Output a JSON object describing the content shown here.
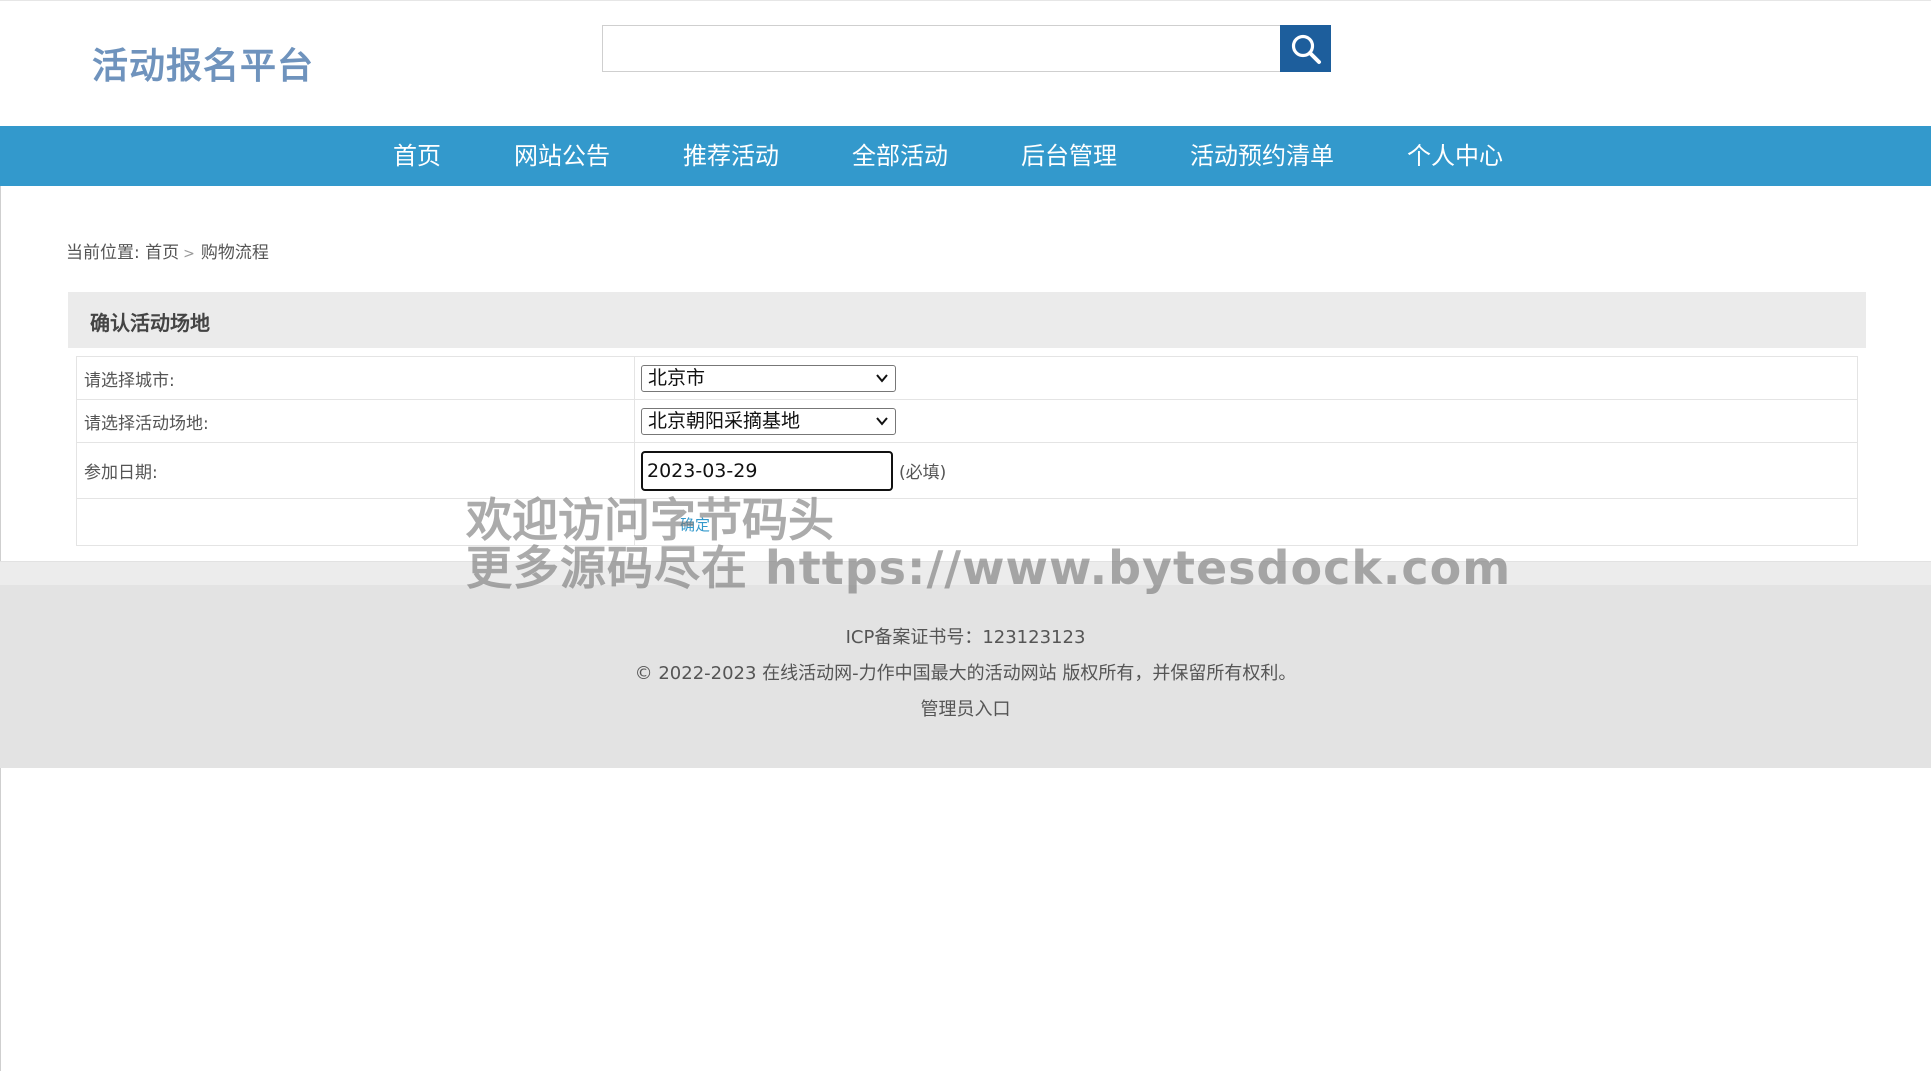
{
  "site": {
    "logo": "活动报名平台"
  },
  "search": {
    "placeholder": "",
    "button_icon": "search-icon"
  },
  "nav": {
    "items": [
      {
        "label": "首页"
      },
      {
        "label": "网站公告"
      },
      {
        "label": "推荐活动"
      },
      {
        "label": "全部活动"
      },
      {
        "label": "后台管理"
      },
      {
        "label": "活动预约清单"
      },
      {
        "label": "个人中心"
      }
    ]
  },
  "breadcrumb": {
    "prefix": "当前位置:",
    "home": "首页",
    "current": "购物流程"
  },
  "section": {
    "title": "确认活动场地"
  },
  "form": {
    "city_label": "请选择城市:",
    "city_value": "北京市",
    "venue_label": "请选择活动场地:",
    "venue_value": "北京朝阳采摘基地",
    "date_label": "参加日期:",
    "date_value": "2023-03-29",
    "required_note": "(必填)",
    "confirm_label": "确定"
  },
  "watermark": {
    "line1": "欢迎访问字节码头",
    "line2": "更多源码尽在  https://www.bytesdock.com"
  },
  "footer": {
    "icp": "ICP备案证书号：123123123",
    "copyright": "© 2022-2023 在线活动网-力作中国最大的活动网站 版权所有，并保留所有权利。",
    "admin_link": "管理员入口"
  },
  "colors": {
    "nav_bg": "#3399cc",
    "search_button": "#1d5e9c",
    "logo": "#6f93bd",
    "footer_bg": "#e3e3e3"
  }
}
